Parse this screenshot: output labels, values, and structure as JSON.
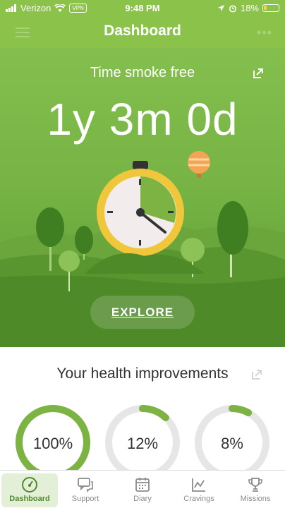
{
  "status_bar": {
    "carrier": "Verizon",
    "vpn": "VPN",
    "time": "9:48 PM",
    "battery": "18%"
  },
  "header": {
    "title": "Dashboard"
  },
  "hero": {
    "subtitle": "Time smoke free",
    "counter": "1y 3m 0d",
    "explore_label": "EXPLORE"
  },
  "health": {
    "title": "Your health improvements",
    "items": [
      {
        "percent_label": "100%",
        "progress": 1.0
      },
      {
        "percent_label": "12%",
        "progress": 0.12
      },
      {
        "percent_label": "8%",
        "progress": 0.08
      }
    ]
  },
  "tabs": [
    {
      "label": "Dashboard",
      "icon": "speedometer-icon",
      "active": true
    },
    {
      "label": "Support",
      "icon": "chat-bubbles-icon",
      "active": false
    },
    {
      "label": "Diary",
      "icon": "calendar-icon",
      "active": false
    },
    {
      "label": "Cravings",
      "icon": "line-chart-icon",
      "active": false
    },
    {
      "label": "Missions",
      "icon": "trophy-icon",
      "active": false
    }
  ],
  "colors": {
    "brand_green": "#8bc34a",
    "ring_green": "#7cb342",
    "ring_track": "#e6e6e6",
    "active_tab_bg": "#e4efd8"
  }
}
